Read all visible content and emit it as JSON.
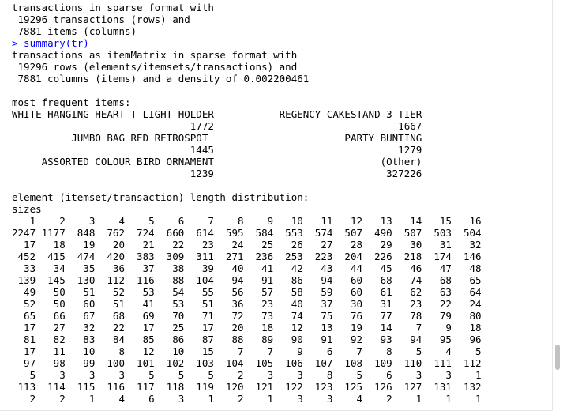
{
  "console": {
    "lines": [
      {
        "text": "transactions in sparse format with",
        "kind": "output"
      },
      {
        "text": " 19296 transactions (rows) and",
        "kind": "output"
      },
      {
        "text": " 7881 items (columns)",
        "kind": "output"
      },
      {
        "text": "> summary(tr)",
        "kind": "prompt"
      },
      {
        "text": "transactions as itemMatrix in sparse format with",
        "kind": "output"
      },
      {
        "text": " 19296 rows (elements/itemsets/transactions) and",
        "kind": "output"
      },
      {
        "text": " 7881 columns (items) and a density of 0.002200461",
        "kind": "output"
      },
      {
        "text": "",
        "kind": "output"
      },
      {
        "text": "most frequent items:",
        "kind": "output"
      },
      {
        "text": "WHITE HANGING HEART T-LIGHT HOLDER           REGENCY CAKESTAND 3 TIER",
        "kind": "output"
      },
      {
        "text": "                              1772                               1667",
        "kind": "output"
      },
      {
        "text": "          JUMBO BAG RED RETROSPOT                       PARTY BUNTING",
        "kind": "output"
      },
      {
        "text": "                              1445                               1279",
        "kind": "output"
      },
      {
        "text": "     ASSORTED COLOUR BIRD ORNAMENT                            (Other)",
        "kind": "output"
      },
      {
        "text": "                              1239                             327226",
        "kind": "output"
      },
      {
        "text": "",
        "kind": "output"
      },
      {
        "text": "element (itemset/transaction) length distribution:",
        "kind": "output"
      },
      {
        "text": "sizes",
        "kind": "output"
      },
      {
        "text": "   1    2    3    4    5    6    7    8    9   10   11   12   13   14   15   16",
        "kind": "output"
      },
      {
        "text": "2247 1177  848  762  724  660  614  595  584  553  574  507  490  507  503  504",
        "kind": "output"
      },
      {
        "text": "  17   18   19   20   21   22   23   24   25   26   27   28   29   30   31   32",
        "kind": "output"
      },
      {
        "text": " 452  415  474  420  383  309  311  271  236  253  223  204  226  218  174  146",
        "kind": "output"
      },
      {
        "text": "  33   34   35   36   37   38   39   40   41   42   43   44   45   46   47   48",
        "kind": "output"
      },
      {
        "text": " 139  145  130  112  116   88  104   94   91   86   94   60   68   74   68   65",
        "kind": "output"
      },
      {
        "text": "  49   50   51   52   53   54   55   56   57   58   59   60   61   62   63   64",
        "kind": "output"
      },
      {
        "text": "  52   50   60   51   41   53   51   36   23   40   37   30   31   23   22   24",
        "kind": "output"
      },
      {
        "text": "  65   66   67   68   69   70   71   72   73   74   75   76   77   78   79   80",
        "kind": "output"
      },
      {
        "text": "  17   27   32   22   17   25   17   20   18   12   13   19   14    7    9   18",
        "kind": "output"
      },
      {
        "text": "  81   82   83   84   85   86   87   88   89   90   91   92   93   94   95   96",
        "kind": "output"
      },
      {
        "text": "  17   11   10    8   12   10   15    7    7    9    6    7    8    5    4    5",
        "kind": "output"
      },
      {
        "text": "  97   98   99  100  101  102  103  104  105  106  107  108  109  110  111  112",
        "kind": "output"
      },
      {
        "text": "   5    3    3    3    5    5    5    2    3    3    8    5    6    3    3    1",
        "kind": "output"
      },
      {
        "text": " 113  114  115  116  117  118  119  120  121  122  123  125  126  127  131  132",
        "kind": "output"
      },
      {
        "text": "   2    2    1    4    6    3    1    2    1    3    3    4    2    1    1    1",
        "kind": "output"
      }
    ]
  },
  "colors": {
    "output_text": "#000000",
    "prompt_text": "#0000ff",
    "background": "#ffffff"
  }
}
